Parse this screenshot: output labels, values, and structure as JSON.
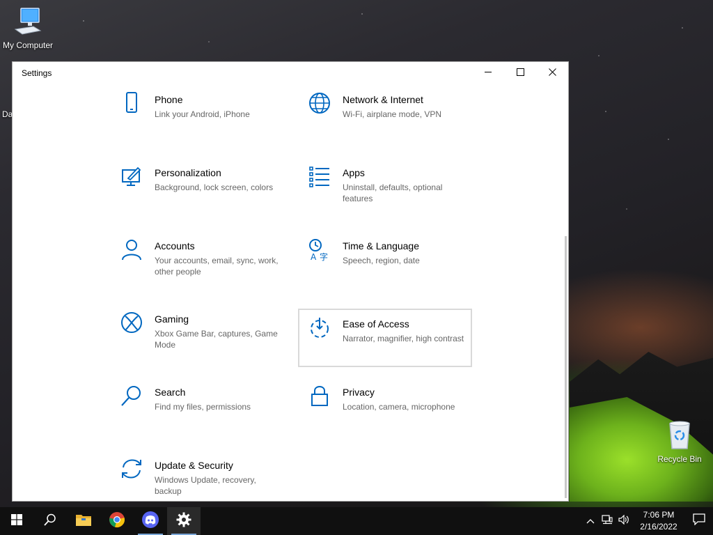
{
  "desktop": {
    "icons": [
      {
        "label": "My Computer"
      },
      {
        "label": "Recycle Bin"
      }
    ],
    "stray_text": "Da"
  },
  "window": {
    "title": "Settings",
    "controls": {
      "minimize": "minimize-icon",
      "maximize": "maximize-icon",
      "close": "close-icon"
    }
  },
  "settings": {
    "accent": "#0067c0",
    "tiles": [
      {
        "name": "Phone",
        "desc": "Link your Android, iPhone",
        "icon": "phone-icon"
      },
      {
        "name": "Network & Internet",
        "desc": "Wi-Fi, airplane mode, VPN",
        "icon": "globe-icon"
      },
      {
        "name": "Personalization",
        "desc": "Background, lock screen, colors",
        "icon": "personalization-icon"
      },
      {
        "name": "Apps",
        "desc": "Uninstall, defaults, optional features",
        "icon": "apps-list-icon"
      },
      {
        "name": "Accounts",
        "desc": "Your accounts, email, sync, work, other people",
        "icon": "person-icon"
      },
      {
        "name": "Time & Language",
        "desc": "Speech, region, date",
        "icon": "time-language-icon"
      },
      {
        "name": "Gaming",
        "desc": "Xbox Game Bar, captures, Game Mode",
        "icon": "xbox-icon"
      },
      {
        "name": "Ease of Access",
        "desc": "Narrator, magnifier, high contrast",
        "icon": "ease-of-access-icon"
      },
      {
        "name": "Search",
        "desc": "Find my files, permissions",
        "icon": "search-icon"
      },
      {
        "name": "Privacy",
        "desc": "Location, camera, microphone",
        "icon": "lock-icon"
      },
      {
        "name": "Update & Security",
        "desc": "Windows Update, recovery, backup",
        "icon": "sync-arrows-icon"
      }
    ]
  },
  "taskbar": {
    "apps": [
      "windows-start-icon",
      "search-icon",
      "file-explorer-icon",
      "chrome-icon",
      "discord-icon",
      "settings-gear-icon"
    ],
    "tray": {
      "time": "7:06 PM",
      "date": "2/16/2022",
      "icons": [
        "chevron-up-icon",
        "network-icon",
        "volume-icon",
        "action-center-icon"
      ]
    }
  }
}
